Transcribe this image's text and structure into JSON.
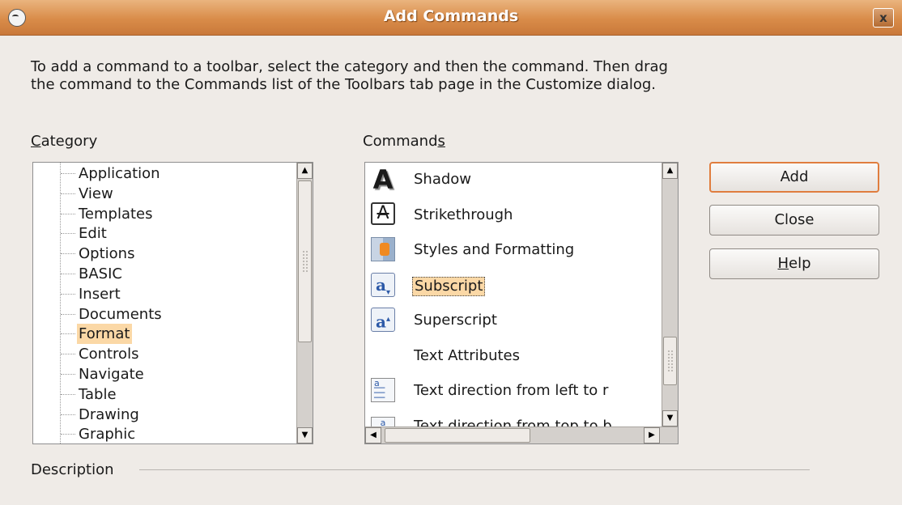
{
  "window": {
    "title": "Add Commands",
    "close_label": "x"
  },
  "intro_text": "To add a command to a toolbar, select the category and then the command. Then drag the command to the Commands list of the Toolbars tab page in the Customize dialog.",
  "category": {
    "label_pre": "",
    "label_mnemonic": "C",
    "label_post": "ategory",
    "items": [
      "Application",
      "View",
      "Templates",
      "Edit",
      "Options",
      "BASIC",
      "Insert",
      "Documents",
      "Format",
      "Controls",
      "Navigate",
      "Table",
      "Drawing",
      "Graphic"
    ],
    "selected": "Format"
  },
  "commands": {
    "label_pre": "Command",
    "label_mnemonic": "s",
    "label_post": "",
    "items": [
      {
        "label": "Shadow",
        "icon": "shadow-icon"
      },
      {
        "label": "Strikethrough",
        "icon": "strikethrough-icon"
      },
      {
        "label": "Styles and Formatting",
        "icon": "styles-formatting-icon"
      },
      {
        "label": "Subscript",
        "icon": "subscript-icon"
      },
      {
        "label": "Superscript",
        "icon": "superscript-icon"
      },
      {
        "label": "Text Attributes",
        "icon": ""
      },
      {
        "label": "Text direction from left to r",
        "icon": "text-direction-ltr-icon"
      },
      {
        "label": "Text direction from top to b",
        "icon": "text-direction-ttb-icon"
      }
    ],
    "selected": "Subscript"
  },
  "buttons": {
    "add": "Add",
    "close": "Close",
    "help_mnemonic": "H",
    "help_rest": "elp"
  },
  "description_label": "Description",
  "colors": {
    "titlebar": "#d98c49",
    "selection": "#fbd8a6",
    "default_button_border": "#e07d3e"
  }
}
